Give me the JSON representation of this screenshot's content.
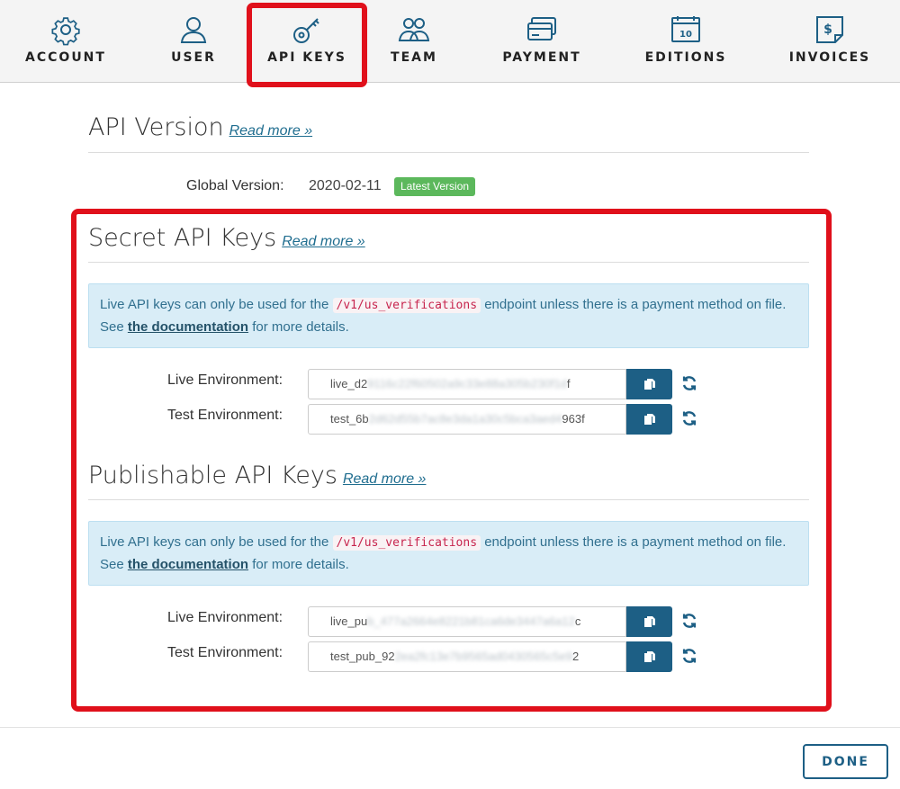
{
  "nav": {
    "tabs": [
      {
        "label": "ACCOUNT",
        "icon": "gear-icon"
      },
      {
        "label": "USER",
        "icon": "user-icon"
      },
      {
        "label": "API KEYS",
        "icon": "key-icon",
        "active": true
      },
      {
        "label": "TEAM",
        "icon": "team-icon"
      },
      {
        "label": "PAYMENT",
        "icon": "credit-card-icon"
      },
      {
        "label": "EDITIONS",
        "icon": "calendar-icon"
      },
      {
        "label": "INVOICES",
        "icon": "invoice-icon"
      }
    ]
  },
  "api_version": {
    "title": "API Version",
    "read_more": "Read more »",
    "global_label": "Global Version:",
    "global_value": "2020-02-11",
    "badge": "Latest Version"
  },
  "secret": {
    "title": "Secret API Keys",
    "read_more": "Read more »",
    "alert": {
      "pre": "Live API keys can only be used for the ",
      "code": "/v1/us_verifications",
      "mid": " endpoint unless there is a payment method on file. See ",
      "link": "the documentation",
      "post": " for more details."
    },
    "live_label": "Live Environment:",
    "live_prefix": "live_d2",
    "live_blur": "9116c22f60502a9c33e88a305b230f1d",
    "live_suffix": "f",
    "test_label": "Test Environment:",
    "test_prefix": "test_6b",
    "test_blur": "2d62d55b7ac8e3da1a30c5bca3aed4",
    "test_suffix": "963f"
  },
  "publishable": {
    "title": "Publishable API Keys",
    "read_more": "Read more »",
    "alert": {
      "pre": "Live API keys can only be used for the ",
      "code": "/v1/us_verifications",
      "mid": " endpoint unless there is a payment method on file. See ",
      "link": "the documentation",
      "post": " for more details."
    },
    "live_label": "Live Environment:",
    "live_prefix": "live_pu",
    "live_blur": "b_477a2664e8221b81ca6de3447a6a12",
    "live_suffix": "c",
    "test_label": "Test Environment:",
    "test_prefix": "test_pub_92",
    "test_blur": "2ea2fc13e7b9565ad0430565c5e9",
    "test_suffix": "2"
  },
  "footer": {
    "done": "DONE"
  },
  "colors": {
    "accent": "#1d5f85",
    "highlight": "#e0101b",
    "badge": "#5cb85c",
    "alert_bg": "#d9edf7"
  }
}
